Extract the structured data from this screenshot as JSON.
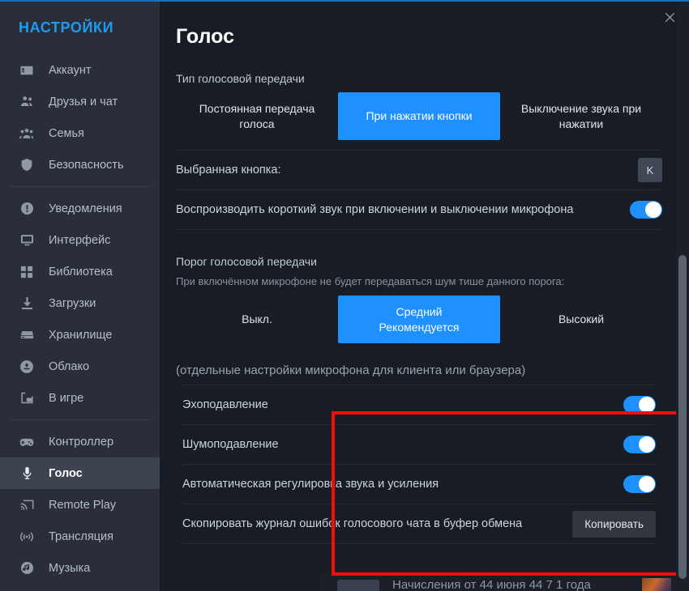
{
  "window": {
    "close_label": "✕",
    "accent_color": "#1e90ff",
    "highlight_color": "#f40d0d"
  },
  "sidebar": {
    "title": "НАСТРОЙКИ",
    "items": [
      {
        "label": "Аккаунт",
        "icon": "account-card-icon",
        "selected": false
      },
      {
        "label": "Друзья и чат",
        "icon": "friends-icon",
        "selected": false
      },
      {
        "label": "Семья",
        "icon": "family-icon",
        "selected": false
      },
      {
        "label": "Безопасность",
        "icon": "shield-icon",
        "selected": false
      },
      {
        "label": "Уведомления",
        "icon": "bell-notification-icon",
        "selected": false
      },
      {
        "label": "Интерфейс",
        "icon": "monitor-icon",
        "selected": false
      },
      {
        "label": "Библиотека",
        "icon": "grid-library-icon",
        "selected": false
      },
      {
        "label": "Загрузки",
        "icon": "download-icon",
        "selected": false
      },
      {
        "label": "Хранилище",
        "icon": "storage-drive-icon",
        "selected": false
      },
      {
        "label": "Облако",
        "icon": "cloud-icon",
        "selected": false
      },
      {
        "label": "В игре",
        "icon": "in-game-icon",
        "selected": false
      },
      {
        "label": "Контроллер",
        "icon": "gamepad-icon",
        "selected": false
      },
      {
        "label": "Голос",
        "icon": "microphone-icon",
        "selected": true
      },
      {
        "label": "Remote Play",
        "icon": "cast-icon",
        "selected": false
      },
      {
        "label": "Трансляция",
        "icon": "broadcast-icon",
        "selected": false
      },
      {
        "label": "Музыка",
        "icon": "music-note-icon",
        "selected": false
      }
    ],
    "separator_after_indices": [
      3,
      10
    ]
  },
  "main": {
    "page_title": "Голос",
    "transmission": {
      "label": "Тип голосовой передачи",
      "options": [
        {
          "label": "Постоянная передача голоса",
          "active": false
        },
        {
          "label": "При нажатии кнопки",
          "active": true
        },
        {
          "label": "Выключение звука при нажатии",
          "active": false
        }
      ]
    },
    "selected_key": {
      "label": "Выбранная кнопка:",
      "value": "K"
    },
    "play_sound": {
      "label": "Воспроизводить короткий звук при включении и выключении микрофона",
      "enabled": true
    },
    "threshold": {
      "label": "Порог голосовой передачи",
      "description": "При включённом микрофоне не будет передаваться шум тише данного порога:",
      "options": [
        {
          "label": "Выкл.",
          "sub": "",
          "active": false
        },
        {
          "label": "Средний",
          "sub": "Рекомендуется",
          "active": true
        },
        {
          "label": "Высокий",
          "sub": "",
          "active": false
        }
      ]
    },
    "mic_note": "(отдельные настройки микрофона для клиента или браузера)",
    "mic_settings": [
      {
        "label": "Эхоподавление",
        "control": "toggle",
        "enabled": true
      },
      {
        "label": "Шумоподавление",
        "control": "toggle",
        "enabled": true
      },
      {
        "label": "Автоматическая регулировка звука и усиления",
        "control": "toggle",
        "enabled": true
      },
      {
        "label": "Скопировать журнал ошибок голосового чата в буфер обмена",
        "control": "button",
        "button_label": "Копировать"
      }
    ],
    "bottom_partial": "Начисления от 44 июня 44 7 1 года"
  }
}
